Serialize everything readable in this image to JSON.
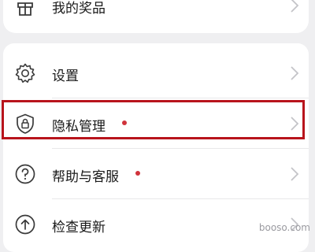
{
  "menu": {
    "prizes": {
      "label": "我的奖品",
      "icon": "gift-icon"
    },
    "settings": {
      "label": "设置",
      "icon": "gear-icon"
    },
    "privacy": {
      "label": "隐私管理",
      "icon": "shield-lock-icon",
      "has_badge": true
    },
    "help": {
      "label": "帮助与客服",
      "icon": "question-circle-icon",
      "has_badge": true
    },
    "update": {
      "label": "检查更新",
      "icon": "arrow-up-circle-icon"
    }
  },
  "watermark": "booso.com",
  "colors": {
    "background": "#efeff1",
    "card": "#ffffff",
    "highlight_border": "#b8141c",
    "badge": "#d0333b",
    "icon": "#3a3a3a",
    "chevron": "#c4c4c8"
  }
}
